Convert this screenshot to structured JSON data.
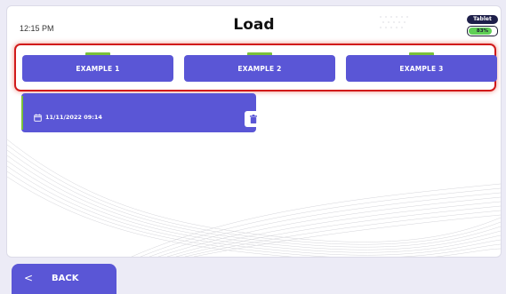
{
  "status": {
    "time": "12:15 PM"
  },
  "header": {
    "title": "Load"
  },
  "device": {
    "label": "Tablet",
    "battery_text": "83%",
    "battery_level": 0.83
  },
  "tabs": [
    {
      "label": "EXAMPLE 1"
    },
    {
      "label": "EXAMPLE 2"
    },
    {
      "label": "EXAMPLE 3"
    }
  ],
  "saves": [
    {
      "date": "11/11/2022 09:14"
    }
  ],
  "footer": {
    "back_label": "BACK"
  },
  "colors": {
    "accent": "#5a56d6",
    "indicator": "#7ac13a",
    "highlight": "#d11a1a",
    "battery": "#5fcf55"
  },
  "icons": {
    "calendar": "calendar-icon",
    "delete": "trash-icon",
    "back": "chevron-left-icon"
  }
}
